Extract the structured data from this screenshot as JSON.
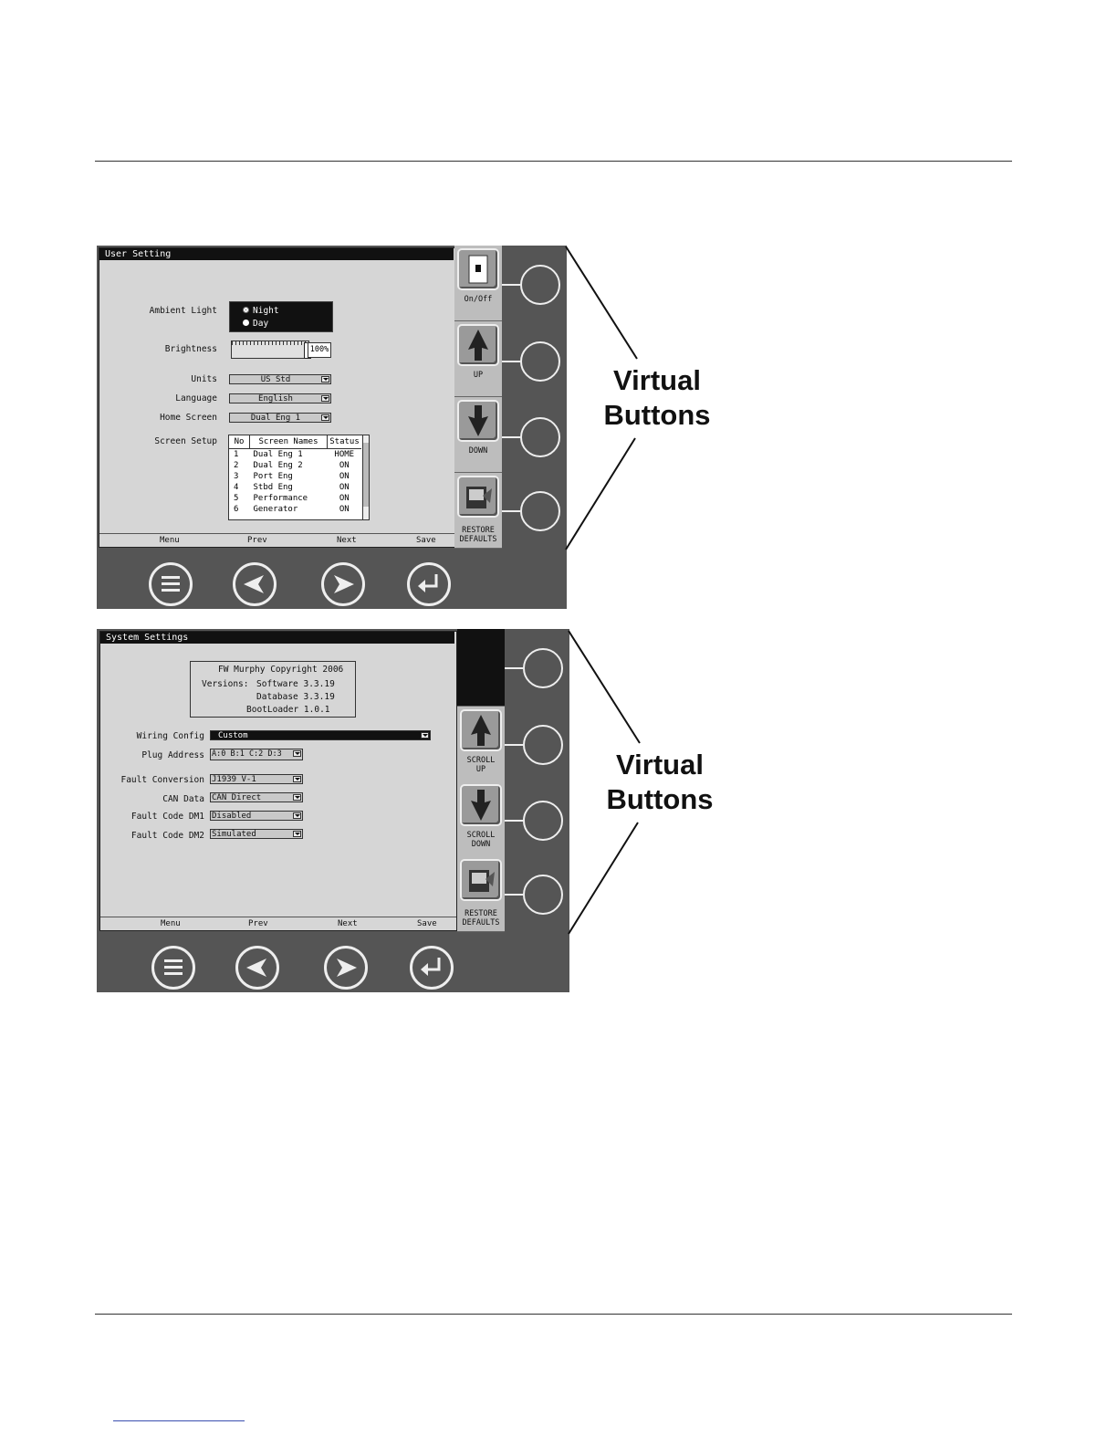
{
  "figure1": {
    "title": "User Setting",
    "ambient_light_label": "Ambient Light",
    "ambient_options": [
      "Night",
      "Day"
    ],
    "ambient_selected": "Night",
    "brightness_label": "Brightness",
    "brightness_value": "100%",
    "brightness_level": 1.0,
    "units_label": "Units",
    "units_value": "US Std",
    "language_label": "Language",
    "language_value": "English",
    "home_screen_label": "Home Screen",
    "home_screen_value": "Dual Eng 1",
    "screen_setup_label": "Screen Setup",
    "table_headers": [
      "No",
      "Screen Names",
      "Status"
    ],
    "table_rows": [
      [
        "1",
        "Dual Eng 1",
        "HOME"
      ],
      [
        "2",
        "Dual Eng 2",
        "ON"
      ],
      [
        "3",
        "Port Eng",
        "ON"
      ],
      [
        "4",
        "Stbd Eng",
        "ON"
      ],
      [
        "5",
        "Performance",
        "ON"
      ],
      [
        "6",
        "Generator",
        "ON"
      ]
    ],
    "softkeys": [
      "Menu",
      "Prev",
      "Next",
      "Save"
    ],
    "virtual_labels": [
      "On/Off",
      "UP",
      "DOWN",
      "RESTORE DEFAULTS"
    ],
    "virtual_icons": [
      "power-switch-icon",
      "arrow-up-icon",
      "arrow-down-icon",
      "restore-defaults-icon"
    ]
  },
  "figure2": {
    "title": "System Settings",
    "copyright": "FW Murphy Copyright 2006",
    "versions_label": "Versions:",
    "software_version": "Software 3.3.19",
    "database_version": "Database 3.3.19",
    "bootloader_version": "BootLoader 1.0.1",
    "wiring_config_label": "Wiring Config",
    "wiring_config_value": "Custom",
    "plug_address_label": "Plug Address",
    "plug_address_value": "A:0 B:1 C:2 D:3",
    "fault_conversion_label": "Fault Conversion",
    "fault_conversion_value": "J1939 V-1",
    "can_data_label": "CAN Data",
    "can_data_value": "CAN Direct",
    "fault_dm1_label": "Fault Code DM1",
    "fault_dm1_value": "Disabled",
    "fault_dm2_label": "Fault Code DM2",
    "fault_dm2_value": "Simulated",
    "softkeys": [
      "Menu",
      "Prev",
      "Next",
      "Save"
    ],
    "virtual_labels": [
      "",
      "SCROLL UP",
      "SCROLL DOWN",
      "RESTORE DEFAULTS"
    ],
    "virtual_icons": [
      "",
      "arrow-up-icon",
      "arrow-down-icon",
      "restore-defaults-icon"
    ]
  },
  "callout_text": "Virtual Buttons",
  "colors": {
    "panel": "#555555",
    "screen": "#d6d6d6",
    "titlebar": "#111111"
  }
}
